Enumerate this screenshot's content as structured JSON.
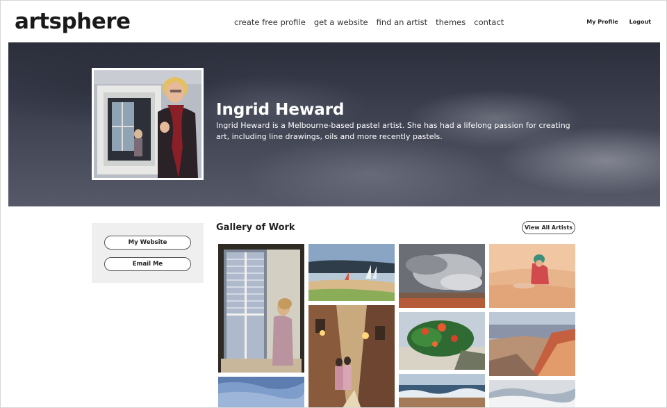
{
  "header": {
    "logo": "artsphere",
    "nav": [
      "create free profile",
      "get a website",
      "find an artist",
      "themes",
      "contact"
    ],
    "account": [
      "My Profile",
      "Logout"
    ]
  },
  "hero": {
    "name": "Ingrid Heward",
    "bio": "Ingrid Heward is a Melbourne-based pastel artist. She has had a lifelong passion for creating art, including line drawings, oils and more recently pastels."
  },
  "sidebar": {
    "website_label": "My Website",
    "email_label": "Email Me"
  },
  "gallery": {
    "title": "Gallery of Work",
    "view_all_label": "View All Artists"
  },
  "colors": {
    "text": "#222222",
    "sidebar_bg": "#efefef",
    "hero_dark": "#2b2e3b"
  }
}
